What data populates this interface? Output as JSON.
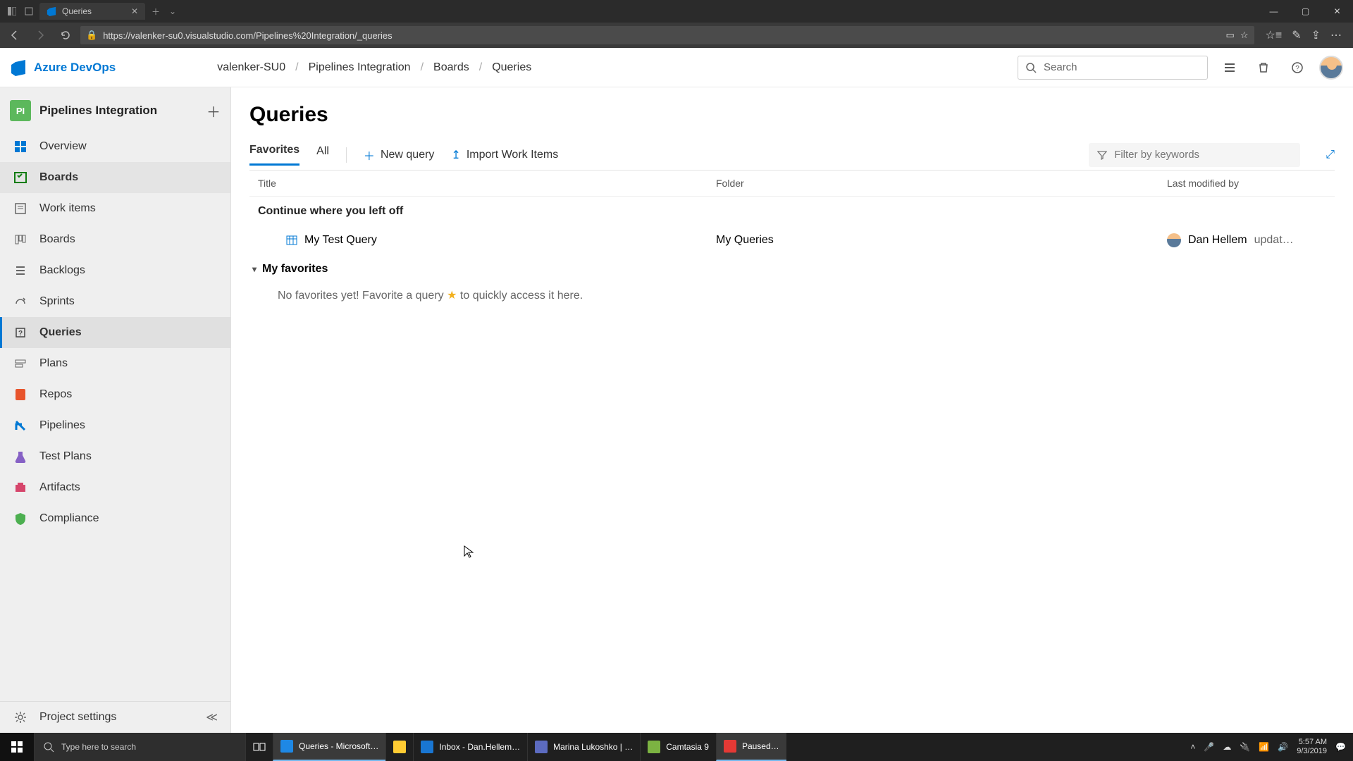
{
  "browser": {
    "tab_title": "Queries",
    "url": "https://valenker-su0.visualstudio.com/Pipelines%20Integration/_queries"
  },
  "product": {
    "name": "Azure DevOps"
  },
  "breadcrumbs": [
    "valenker-SU0",
    "Pipelines Integration",
    "Boards",
    "Queries"
  ],
  "search_placeholder": "Search",
  "project": {
    "badge": "PI",
    "name": "Pipelines Integration"
  },
  "nav": {
    "overview": "Overview",
    "boards": "Boards",
    "work_items": "Work items",
    "boards_sub": "Boards",
    "backlogs": "Backlogs",
    "sprints": "Sprints",
    "queries": "Queries",
    "plans": "Plans",
    "repos": "Repos",
    "pipelines": "Pipelines",
    "test_plans": "Test Plans",
    "artifacts": "Artifacts",
    "compliance": "Compliance",
    "project_settings": "Project settings"
  },
  "page": {
    "title": "Queries",
    "tabs": {
      "favorites": "Favorites",
      "all": "All"
    },
    "actions": {
      "new_query": "New query",
      "import": "Import Work Items"
    },
    "filter_placeholder": "Filter by keywords",
    "columns": {
      "title": "Title",
      "folder": "Folder",
      "modified": "Last modified by"
    },
    "continue_label": "Continue where you left off",
    "recent": {
      "title": "My Test Query",
      "folder": "My Queries",
      "modified_by": "Dan Hellem",
      "modified_suffix": "updat…"
    },
    "favorites_label": "My favorites",
    "empty_favorites_pre": "No favorites yet! Favorite a query ",
    "empty_favorites_post": " to quickly access it here."
  },
  "taskbar": {
    "search_placeholder": "Type here to search",
    "apps": [
      {
        "label": "Queries - Microsoft…",
        "color": "#1e88e5"
      },
      {
        "label": "",
        "color": "#ffcc33"
      },
      {
        "label": "Inbox - Dan.Hellem…",
        "color": "#1976d2"
      },
      {
        "label": "Marina Lukoshko | …",
        "color": "#5c6bc0"
      },
      {
        "label": "Camtasia 9",
        "color": "#7cb342"
      },
      {
        "label": "Paused…",
        "color": "#e53935"
      }
    ],
    "time": "5:57 AM",
    "date": "9/3/2019"
  }
}
